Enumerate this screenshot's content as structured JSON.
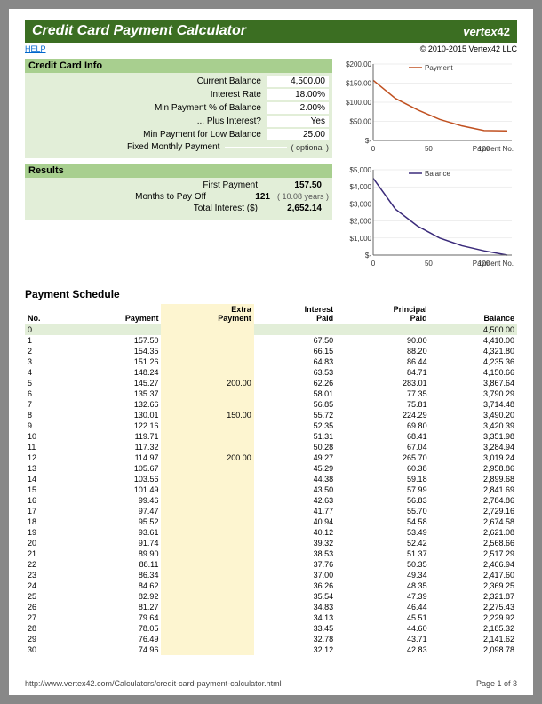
{
  "header": {
    "title": "Credit Card Payment Calculator",
    "logo_prefix": "vertex",
    "logo_num": "42",
    "copyright": "© 2010-2015 Vertex42 LLC",
    "help": "HELP"
  },
  "info": {
    "title": "Credit Card Info",
    "rows": [
      {
        "label": "Current Balance",
        "val": "4,500.00"
      },
      {
        "label": "Interest Rate",
        "val": "18.00%"
      },
      {
        "label": "Min Payment % of Balance",
        "val": "2.00%"
      },
      {
        "label": "... Plus Interest?",
        "val": "Yes"
      },
      {
        "label": "Min Payment for Low Balance",
        "val": "25.00"
      },
      {
        "label": "Fixed Monthly Payment",
        "val": "",
        "note": "( optional )"
      }
    ]
  },
  "results": {
    "title": "Results",
    "rows": [
      {
        "label": "First Payment",
        "val": "157.50",
        "note": ""
      },
      {
        "label": "Months to Pay Off",
        "val": "121",
        "note": "( 10.08 years )"
      },
      {
        "label": "Total Interest ($)",
        "val": "2,652.14",
        "note": ""
      }
    ]
  },
  "chart_data": [
    {
      "type": "line",
      "title": "",
      "series": [
        {
          "name": "Payment",
          "color": "#c05020"
        }
      ],
      "x": [
        0,
        20,
        40,
        60,
        80,
        100,
        121
      ],
      "values": [
        157.5,
        110,
        80,
        55,
        38,
        26,
        25
      ],
      "xlim": [
        0,
        125
      ],
      "ylim": [
        0,
        200
      ],
      "yticks": [
        "$-",
        "$50.00",
        "$100.00",
        "$150.00",
        "$200.00"
      ],
      "xlabel": "Payment No."
    },
    {
      "type": "line",
      "title": "",
      "series": [
        {
          "name": "Balance",
          "color": "#3a2a7a"
        }
      ],
      "x": [
        0,
        20,
        40,
        60,
        80,
        100,
        121
      ],
      "values": [
        4500,
        2700,
        1700,
        1000,
        550,
        250,
        0
      ],
      "xlim": [
        0,
        125
      ],
      "ylim": [
        0,
        5000
      ],
      "yticks": [
        "$-",
        "$1,000",
        "$2,000",
        "$3,000",
        "$4,000",
        "$5,000"
      ],
      "xlabel": "Payment No."
    }
  ],
  "schedule": {
    "title": "Payment Schedule",
    "headers": [
      "No.",
      "Payment",
      "Extra Payment",
      "Interest Paid",
      "Principal Paid",
      "Balance"
    ],
    "rows": [
      [
        "0",
        "",
        "",
        "",
        "",
        "4,500.00"
      ],
      [
        "1",
        "157.50",
        "",
        "67.50",
        "90.00",
        "4,410.00"
      ],
      [
        "2",
        "154.35",
        "",
        "66.15",
        "88.20",
        "4,321.80"
      ],
      [
        "3",
        "151.26",
        "",
        "64.83",
        "86.44",
        "4,235.36"
      ],
      [
        "4",
        "148.24",
        "",
        "63.53",
        "84.71",
        "4,150.66"
      ],
      [
        "5",
        "145.27",
        "200.00",
        "62.26",
        "283.01",
        "3,867.64"
      ],
      [
        "6",
        "135.37",
        "",
        "58.01",
        "77.35",
        "3,790.29"
      ],
      [
        "7",
        "132.66",
        "",
        "56.85",
        "75.81",
        "3,714.48"
      ],
      [
        "8",
        "130.01",
        "150.00",
        "55.72",
        "224.29",
        "3,490.20"
      ],
      [
        "9",
        "122.16",
        "",
        "52.35",
        "69.80",
        "3,420.39"
      ],
      [
        "10",
        "119.71",
        "",
        "51.31",
        "68.41",
        "3,351.98"
      ],
      [
        "11",
        "117.32",
        "",
        "50.28",
        "67.04",
        "3,284.94"
      ],
      [
        "12",
        "114.97",
        "200.00",
        "49.27",
        "265.70",
        "3,019.24"
      ],
      [
        "13",
        "105.67",
        "",
        "45.29",
        "60.38",
        "2,958.86"
      ],
      [
        "14",
        "103.56",
        "",
        "44.38",
        "59.18",
        "2,899.68"
      ],
      [
        "15",
        "101.49",
        "",
        "43.50",
        "57.99",
        "2,841.69"
      ],
      [
        "16",
        "99.46",
        "",
        "42.63",
        "56.83",
        "2,784.86"
      ],
      [
        "17",
        "97.47",
        "",
        "41.77",
        "55.70",
        "2,729.16"
      ],
      [
        "18",
        "95.52",
        "",
        "40.94",
        "54.58",
        "2,674.58"
      ],
      [
        "19",
        "93.61",
        "",
        "40.12",
        "53.49",
        "2,621.08"
      ],
      [
        "20",
        "91.74",
        "",
        "39.32",
        "52.42",
        "2,568.66"
      ],
      [
        "21",
        "89.90",
        "",
        "38.53",
        "51.37",
        "2,517.29"
      ],
      [
        "22",
        "88.11",
        "",
        "37.76",
        "50.35",
        "2,466.94"
      ],
      [
        "23",
        "86.34",
        "",
        "37.00",
        "49.34",
        "2,417.60"
      ],
      [
        "24",
        "84.62",
        "",
        "36.26",
        "48.35",
        "2,369.25"
      ],
      [
        "25",
        "82.92",
        "",
        "35.54",
        "47.39",
        "2,321.87"
      ],
      [
        "26",
        "81.27",
        "",
        "34.83",
        "46.44",
        "2,275.43"
      ],
      [
        "27",
        "79.64",
        "",
        "34.13",
        "45.51",
        "2,229.92"
      ],
      [
        "28",
        "78.05",
        "",
        "33.45",
        "44.60",
        "2,185.32"
      ],
      [
        "29",
        "76.49",
        "",
        "32.78",
        "43.71",
        "2,141.62"
      ],
      [
        "30",
        "74.96",
        "",
        "32.12",
        "42.83",
        "2,098.78"
      ]
    ]
  },
  "footer": {
    "url": "http://www.vertex42.com/Calculators/credit-card-payment-calculator.html",
    "page": "Page 1 of 3"
  }
}
